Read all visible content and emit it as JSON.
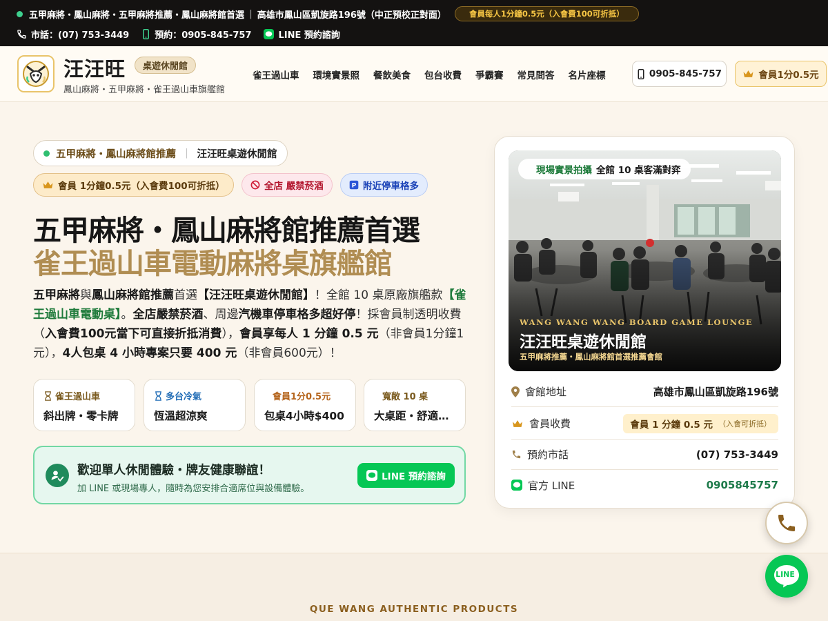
{
  "topbar": {
    "tagline": "五甲麻將・鳳山麻將・五甲麻將推薦・鳳山麻將館首選",
    "address": "高雄市鳳山區凱旋路196號（中正預校正對面）",
    "promo": "會員每人1分鐘0.5元（入會費100可折抵）",
    "phone_label": "市話：(07) 753-3449",
    "mobile_label": "預約：0905-845-757",
    "line_label": "LINE 預約諮詢"
  },
  "header": {
    "brand_name": "汪汪旺",
    "brand_tag": "桌遊休閒館",
    "brand_sub": "鳳山麻將・五甲麻將・雀王過山車旗艦館",
    "nav": [
      "雀王過山車",
      "環境實景照",
      "餐飲美食",
      "包台收費",
      "爭霸賽",
      "常見問答",
      "名片座標"
    ],
    "phone_button": "0905-845-757",
    "member_button": "會員1分0.5元"
  },
  "hero": {
    "pill_left": "五甲麻將・鳳山麻將館推薦",
    "pill_sep": "｜",
    "pill_right": "汪汪旺桌遊休閒館",
    "chip_member": "會員 1分鐘0.5元（入會費100可折抵）",
    "chip_smoke_red": "全店",
    "chip_smoke": "嚴禁菸酒",
    "chip_parking": "附近停車格多",
    "title_line1": "五甲麻將・鳳山麻將館推薦首選",
    "title_line2": "雀王過山車電動麻將桌旗艦館",
    "desc": {
      "p1": "五甲麻將",
      "p2": "與",
      "p3": "鳳山麻將館推薦",
      "p4": "首選",
      "p5": "【汪汪旺桌遊休閒館】",
      "p6": "！全館 10 桌原廠旗艦款",
      "p7": "【雀王過山車電動桌】",
      "p8": "。",
      "p9": "全店嚴禁菸酒",
      "p10": "、周邊",
      "p11": "汽機車停車格多超好停",
      "p12": "！採會員制透明收費（",
      "p13": "入會費100元當下可直接折抵消費",
      "p14": "），",
      "p15": "會員享每人 1 分鐘 0.5 元",
      "p16": "（非會員1分鐘1元），",
      "p17": "4人包桌 4 小時專案只要 400 元",
      "p18": "（非會員600元）！"
    },
    "features": [
      {
        "title": "雀王過山車",
        "value": "斜出牌・零卡牌",
        "color": "#7a5a1e"
      },
      {
        "title": "多台冷氣",
        "value": "恆溫超涼爽",
        "color": "#1f6bb5"
      },
      {
        "title": "會員1分0.5元",
        "value": "包桌4小時$400",
        "color": "#b5651d"
      },
      {
        "title": "寬敞 10 桌",
        "value": "大桌距・舒適對弈",
        "color": "#7a5a1e"
      }
    ],
    "cta": {
      "title": "歡迎單人休閒體驗・牌友健康聯誼！",
      "sub": "加 LINE 或現場專人，隨時為您安排合適席位與設備體驗。",
      "button": "LINE 預約諮詢"
    }
  },
  "card": {
    "photo_pill_green": "現場實景拍攝",
    "photo_pill_text": "全館 10 桌客滿對弈",
    "photo_en": "WANG WANG WANG BOARD GAME LOUNGE",
    "photo_zh": "汪汪旺桌遊休閒館",
    "photo_sub": "五甲麻將推薦・鳳山麻將館首選推薦會館",
    "rows": {
      "address_label": "會館地址",
      "address_value": "高雄市鳳山區凱旋路196號",
      "fee_label": "會員收費",
      "fee_value": "會員 1 分鐘 0.5 元",
      "fee_note": "（入會可折抵）",
      "phone_label": "預約市話",
      "phone_value": "(07) 753-3449",
      "line_label": "官方 LINE",
      "line_value": "0905845757"
    }
  },
  "fab": {
    "line_text": "LINE"
  },
  "section": {
    "eyebrow": "QUE WANG AUTHENTIC PRODUCTS"
  },
  "colors": {
    "accent_gold": "#b08d52",
    "line_green": "#06c755",
    "dark_bar": "#141211"
  }
}
